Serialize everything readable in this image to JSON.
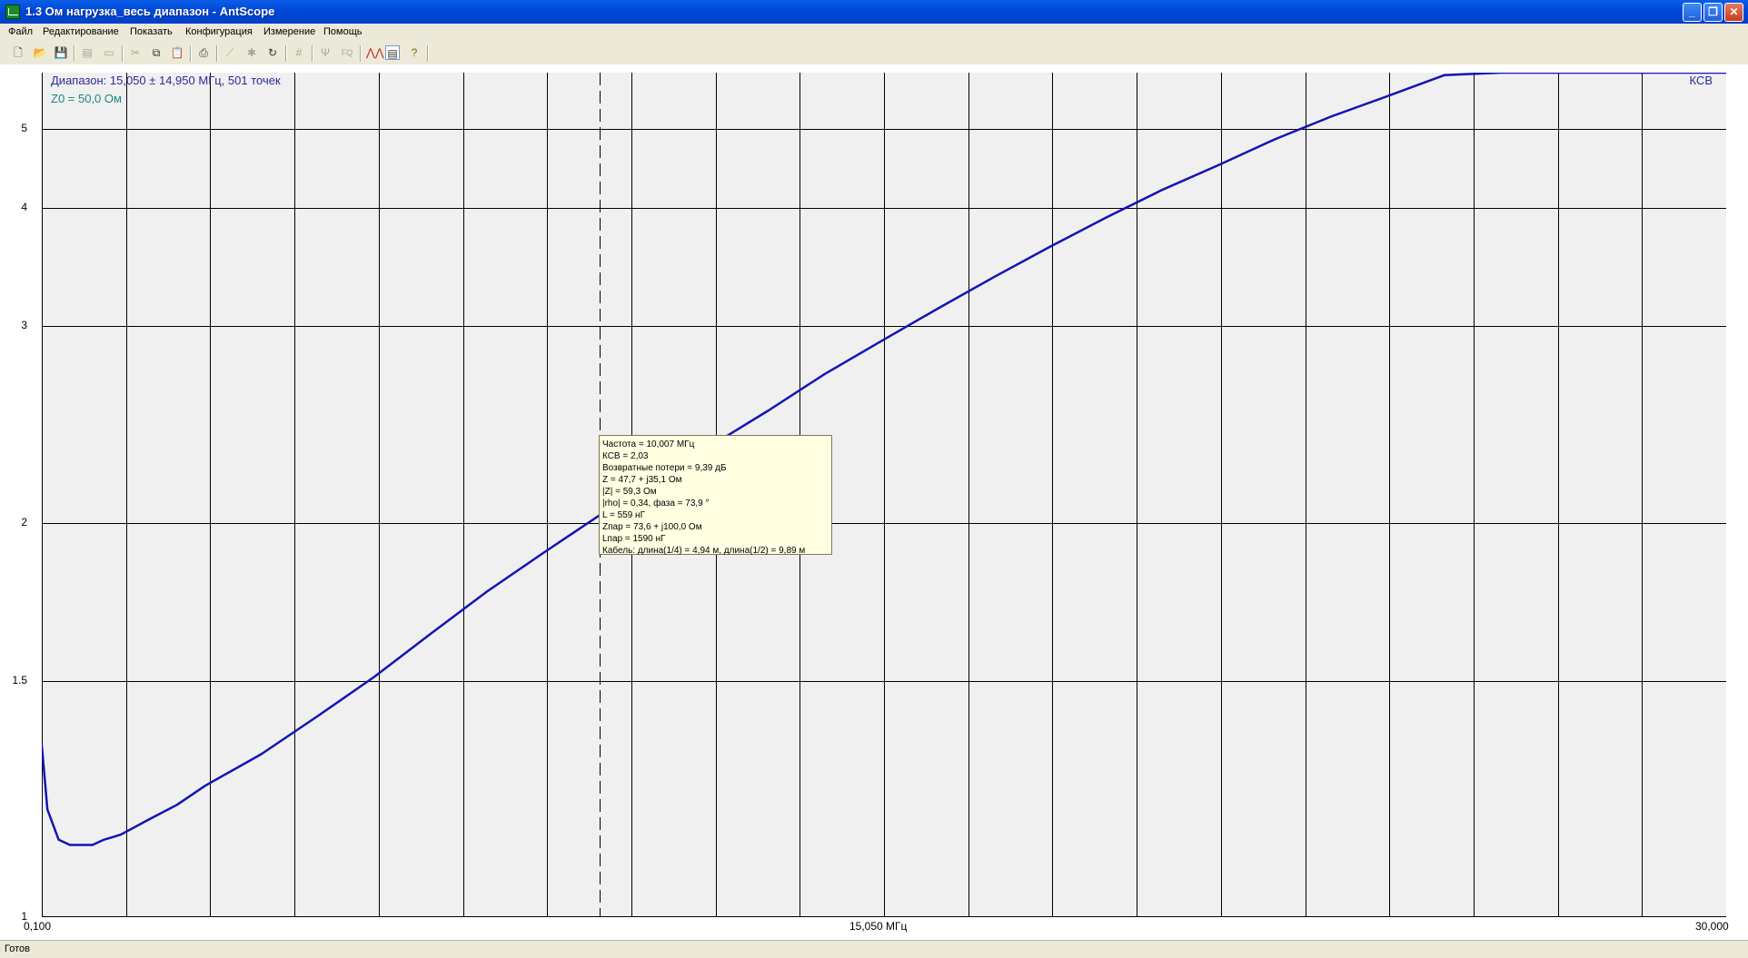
{
  "window": {
    "title": "1.3 Ом нагрузка_весь диапазон - AntScope",
    "controls": {
      "minimize": "_",
      "maximize": "❐",
      "close": "✕"
    }
  },
  "menu": [
    "Файл",
    "Редактирование",
    "Показать",
    "Конфигурация",
    "Измерение",
    "Помощь"
  ],
  "toolbar": {
    "icons": [
      "new-file-icon",
      "open-folder-icon",
      "save-icon",
      "add-marker-icon",
      "camera-icon",
      "cut-icon",
      "copy-icon",
      "paste-icon",
      "print-icon",
      "chart-icon",
      "asterisk-icon",
      "refresh-icon",
      "digits-icon",
      "antenna-icon",
      "fq-icon",
      "graph-icon",
      "notes-icon",
      "help-icon"
    ],
    "fq_label": "FQ"
  },
  "chart_header": {
    "range": "Диапазон: 15,050 ± 14,950 МГц, 501 точек",
    "z0": "Z0 = 50,0 Ом",
    "legend": "КСВ"
  },
  "colors": {
    "line": "#1414b4",
    "plot_bg": "#f0f0f0",
    "grid": "#000000",
    "range_text": "#2b2b9a",
    "z0_text": "#158a7a"
  },
  "tooltip": {
    "lines": [
      "Частота = 10,007 МГц",
      "КСВ = 2,03",
      "Возвратные потери = 9,39 дБ",
      "Z = 47,7 + j35,1 Ом",
      "|Z| = 59,3 Ом",
      "|rho| = 0,34, фаза = 73,9 °",
      "L = 559 нГ",
      "Zпар = 73,6 + j100,0 Ом",
      "Lпар = 1590 нГ",
      "Кабель: длина(1/4) = 4,94 м, длина(1/2) = 9,89 м"
    ]
  },
  "chart_data": {
    "type": "line",
    "xlabel": "МГц",
    "x_tick_labels": [
      "0,100",
      "15,050 МГц",
      "30,000"
    ],
    "xlim": [
      0.1,
      30.0
    ],
    "y_tick_labels": [
      "1",
      "1.5",
      "2",
      "3",
      "4",
      "5"
    ],
    "ylim": [
      1,
      6.0
    ],
    "y_scale": "reflection-coefficient",
    "grid": true,
    "legend": "top-right",
    "marker_x": 10.007,
    "series": [
      {
        "name": "КСВ",
        "x": [
          0.1,
          0.2,
          0.4,
          0.6,
          0.8,
          1.0,
          1.2,
          1.5,
          2.0,
          2.5,
          3.0,
          4.0,
          5.0,
          6.0,
          7.0,
          8.0,
          9.0,
          10.0,
          11.0,
          12.0,
          13.0,
          14.0,
          15.0,
          16.0,
          17.0,
          18.0,
          19.0,
          20.0,
          21.0,
          22.0,
          23.0,
          24.0,
          25.0,
          26.0,
          27.0,
          28.0,
          29.0,
          30.0
        ],
        "y": [
          1.34,
          1.2,
          1.14,
          1.13,
          1.13,
          1.13,
          1.14,
          1.15,
          1.18,
          1.21,
          1.25,
          1.32,
          1.41,
          1.51,
          1.63,
          1.76,
          1.89,
          2.03,
          2.17,
          2.33,
          2.5,
          2.7,
          2.9,
          3.12,
          3.36,
          3.62,
          3.9,
          4.2,
          4.5,
          4.85,
          5.2,
          5.55,
          5.95,
          6.4,
          6.85,
          7.3,
          7.9,
          8.5
        ]
      }
    ]
  },
  "status": "Готов"
}
